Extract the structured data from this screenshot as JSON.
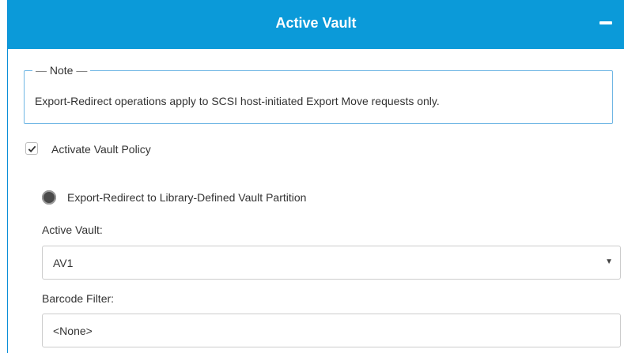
{
  "panel": {
    "title": "Active Vault",
    "collapse_icon": "minus-icon",
    "accent_color": "#0b9ad9"
  },
  "note": {
    "legend": "Note",
    "text": "Export-Redirect operations apply to SCSI host-initiated Export Move requests only."
  },
  "activate_vault_policy": {
    "label": "Activate Vault Policy",
    "checked": true
  },
  "export_redirect": {
    "label": "Export-Redirect to Library-Defined Vault Partition",
    "selected": true
  },
  "active_vault": {
    "label": "Active Vault:",
    "value": "AV1",
    "arrow_icon": "caret-down-icon"
  },
  "barcode_filter": {
    "label": "Barcode Filter:",
    "value": "<None>"
  }
}
